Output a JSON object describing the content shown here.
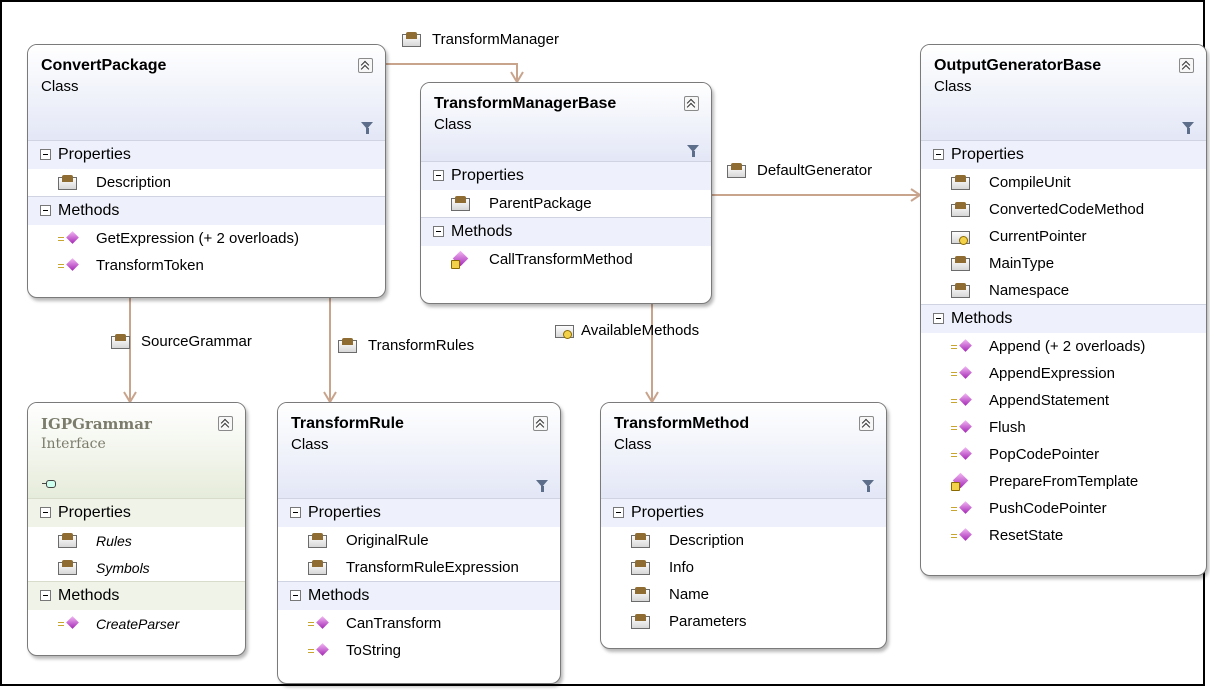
{
  "shapes": {
    "convert_package": {
      "name": "ConvertPackage",
      "kind": "Class",
      "compartments": [
        {
          "label": "Properties",
          "members": [
            {
              "name": "Description",
              "icon": "property-icon"
            }
          ]
        },
        {
          "label": "Methods",
          "members": [
            {
              "name": "GetExpression (+ 2 overloads)",
              "icon": "method-icon"
            },
            {
              "name": "TransformToken",
              "icon": "method-icon"
            }
          ]
        }
      ]
    },
    "transform_manager_base": {
      "name": "TransformManagerBase",
      "kind": "Class",
      "compartments": [
        {
          "label": "Properties",
          "members": [
            {
              "name": "ParentPackage",
              "icon": "property-icon"
            }
          ]
        },
        {
          "label": "Methods",
          "members": [
            {
              "name": "CallTransformMethod",
              "icon": "protected-method-icon"
            }
          ]
        }
      ]
    },
    "output_generator_base": {
      "name": "OutputGeneratorBase",
      "kind": "Class",
      "compartments": [
        {
          "label": "Properties",
          "members": [
            {
              "name": "CompileUnit",
              "icon": "property-icon"
            },
            {
              "name": "ConvertedCodeMethod",
              "icon": "property-icon"
            },
            {
              "name": "CurrentPointer",
              "icon": "protected-property-icon"
            },
            {
              "name": "MainType",
              "icon": "property-icon"
            },
            {
              "name": "Namespace",
              "icon": "property-icon"
            }
          ]
        },
        {
          "label": "Methods",
          "members": [
            {
              "name": "Append (+ 2 overloads)",
              "icon": "method-icon"
            },
            {
              "name": "AppendExpression",
              "icon": "method-icon"
            },
            {
              "name": "AppendStatement",
              "icon": "method-icon"
            },
            {
              "name": "Flush",
              "icon": "method-icon"
            },
            {
              "name": "PopCodePointer",
              "icon": "method-icon"
            },
            {
              "name": "PrepareFromTemplate",
              "icon": "protected-method-icon"
            },
            {
              "name": "PushCodePointer",
              "icon": "method-icon"
            },
            {
              "name": "ResetState",
              "icon": "method-icon"
            }
          ]
        }
      ]
    },
    "igp_grammar": {
      "name": "IGPGrammar",
      "kind": "Interface",
      "compartments": [
        {
          "label": "Properties",
          "members": [
            {
              "name": "Rules",
              "icon": "property-icon"
            },
            {
              "name": "Symbols",
              "icon": "property-icon"
            }
          ]
        },
        {
          "label": "Methods",
          "members": [
            {
              "name": "CreateParser",
              "icon": "method-icon"
            }
          ]
        }
      ]
    },
    "transform_rule": {
      "name": "TransformRule",
      "kind": "Class",
      "compartments": [
        {
          "label": "Properties",
          "members": [
            {
              "name": "OriginalRule",
              "icon": "property-icon"
            },
            {
              "name": "TransformRuleExpression",
              "icon": "property-icon"
            }
          ]
        },
        {
          "label": "Methods",
          "members": [
            {
              "name": "CanTransform",
              "icon": "method-icon"
            },
            {
              "name": "ToString",
              "icon": "method-icon"
            }
          ]
        }
      ]
    },
    "transform_method": {
      "name": "TransformMethod",
      "kind": "Class",
      "compartments": [
        {
          "label": "Properties",
          "members": [
            {
              "name": "Description",
              "icon": "property-icon"
            },
            {
              "name": "Info",
              "icon": "property-icon"
            },
            {
              "name": "Name",
              "icon": "property-icon"
            },
            {
              "name": "Parameters",
              "icon": "property-icon"
            }
          ]
        }
      ]
    }
  },
  "associations": {
    "transform_manager": "TransformManager",
    "default_generator": "DefaultGenerator",
    "source_grammar": "SourceGrammar",
    "transform_rules": "TransformRules",
    "available_methods": "AvailableMethods"
  },
  "colors": {
    "connector": "#c9a48d",
    "class_header": "#e3e7f6",
    "interface_header": "#e6ecdb"
  }
}
